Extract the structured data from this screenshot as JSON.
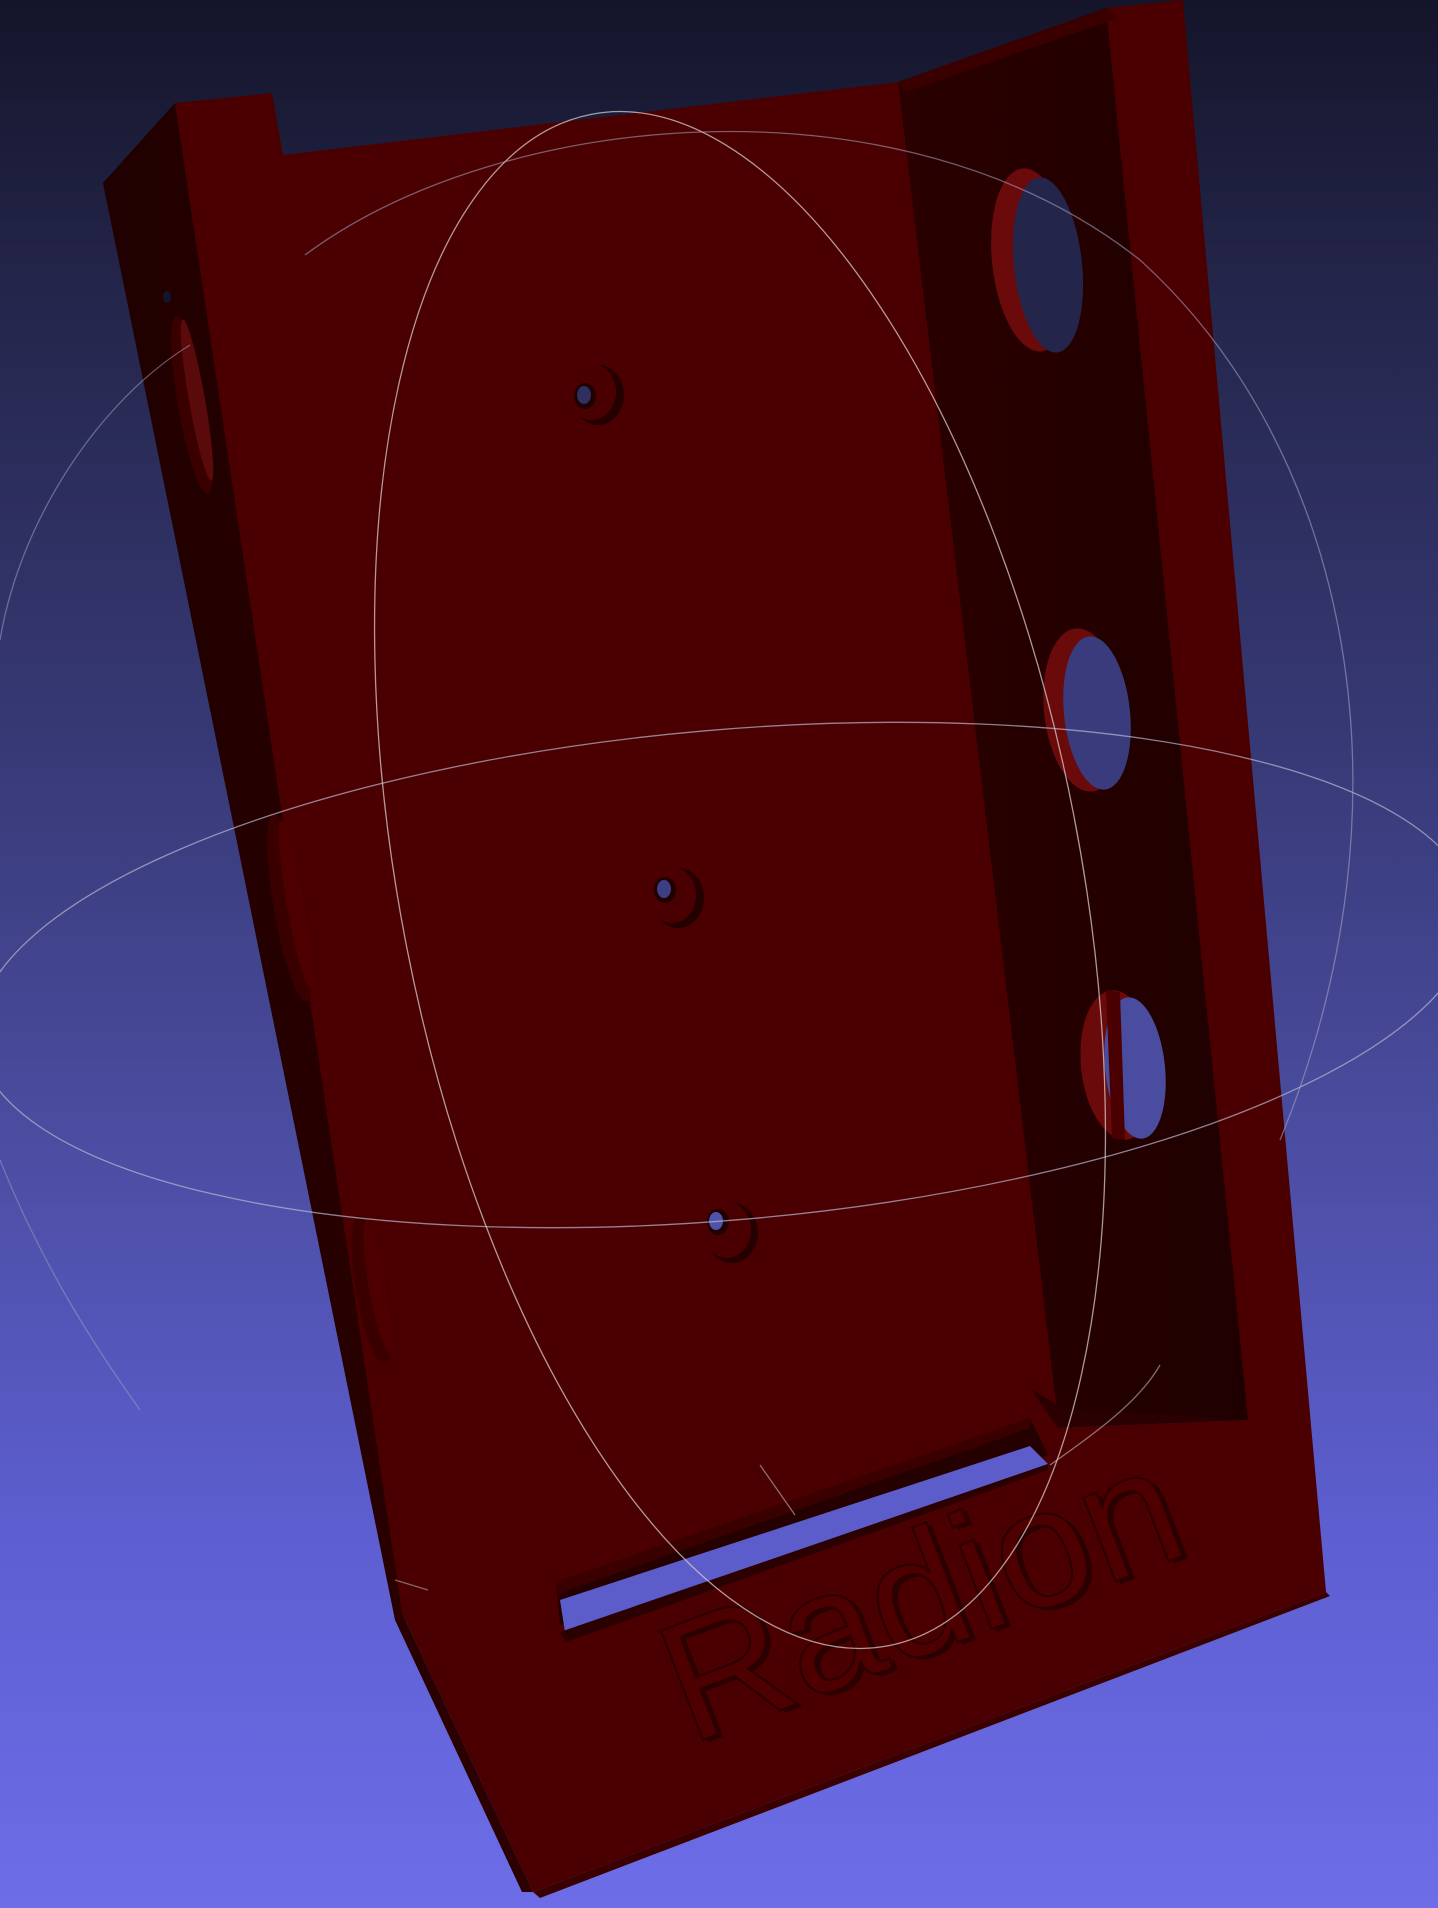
{
  "viewer": {
    "background_top": "#14152a",
    "background_bottom": "#6d6de8"
  },
  "model": {
    "emboss_text": "Radion",
    "color_front": "#4a0000",
    "color_dark": "#240000",
    "color_side": "#2b0000",
    "features": {
      "large_side_holes": 3,
      "mounting_holes": 3,
      "left_wall_slots": 4,
      "bottom_slot": 1
    }
  },
  "trackball": {
    "color": "#c8c8c8"
  }
}
